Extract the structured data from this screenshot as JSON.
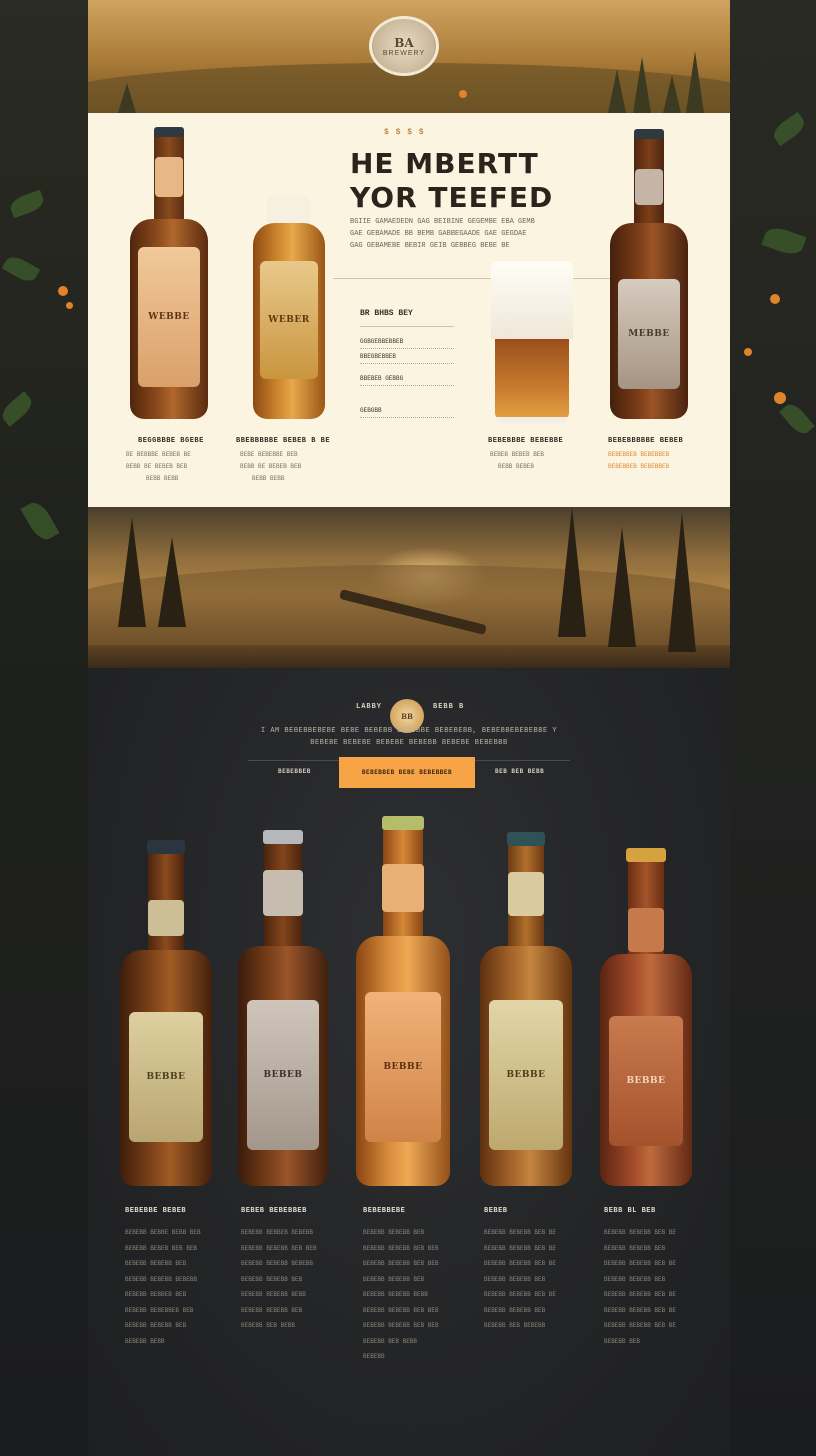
{
  "hero": {
    "badge_title": "BA",
    "badge_sub": "BREWERY"
  },
  "feature": {
    "kicker": "$ $ $ $",
    "headline_line1": "HE MBERTT",
    "headline_line2": "YOR TEEFED",
    "paragraph_lines": [
      "BGIIE GAMAEDEDN GAG BEIBINE GEGEMBE EBA GEMB",
      "GAE GEBAMADE BB BEMB GABBEGAADE GAE GEGDAE",
      "GAG GEBAMEBE BEBIR GEIB GEBBEG BEBE BE"
    ],
    "menu_title": "BR BHBS BEY",
    "menu_items": [
      "GGBGEBBEBBEB",
      "BBEGBEBBEB",
      "BBEBEB GEBBG",
      "GEBGBB"
    ],
    "products": [
      {
        "title": "BEGGBBBE BGEBE",
        "lines": [
          "BE BEBBBE BEBEB BE",
          "BEBB BE BEBEB BEB",
          "BEBB BEBB"
        ]
      },
      {
        "title": "BBEBBBBBE BEBEB B BE",
        "lines": [
          "BEBE BEBEBBE BEB",
          "BEBB BE BEBEB BEB",
          "BEBB BEBB"
        ]
      },
      {
        "title": "BEBEBBBE BEBEBBE",
        "lines": [
          "BEBEB BEBEB BEB",
          "BEBB BEBEB"
        ]
      },
      {
        "title": "BEBEBBBBBE BEBEB",
        "lines": [
          "BEBEBBEB BEBEBBEB",
          "BEBEBBEB BEBEBBEB"
        ]
      }
    ],
    "bottle_labels": [
      "WEBBE",
      "WEBER",
      "MEBBE"
    ]
  },
  "brand": {
    "left": "LABBY",
    "right": "BEBB B",
    "badge": "BB",
    "tagline1": "I AM BEBEBBEBEBE BEBE BEBEBB BEBEBBE BEBEBEBB, BEBEBBEBEBEBBE Y",
    "tagline2": "BEBEBE BEBEBE BEBEBE BEBEBB BEBEBE BEBEBBB"
  },
  "nav": {
    "left": "BEBEBBEB",
    "button": "BEBEBBEB BEBE BEBEBBEB",
    "right": "BEB BEB BEBB"
  },
  "lineup": [
    {
      "label": "BEBBE",
      "title": "BEBEBBE BEBEB",
      "lines": [
        "BEBEBB BEBBE BEBB BEB",
        "BEBEBB BEBEB BEB BEB",
        "BEBEBB BEBEBB BEB",
        "BEBEBB BEBEBB BEBEBB",
        "BEBEBB BEBBEB BEB",
        "BEBEBB BEBEBBEB BEB",
        "BEBEBB BEBEBB BEB",
        "BEBEBB BEBB"
      ]
    },
    {
      "label": "BEBEB",
      "title": "BEBEB BEBEBBEB",
      "lines": [
        "BEBEBB BEBBEB BEBEBB",
        "BEBEBB BEBEBB BEB BEB",
        "BEBEBB BEBEBB BEBEBB",
        "BEBEBB BEBEBB BEB",
        "BEBEBB BEBEBB BEBB",
        "BEBEBB BEBEBB BEB",
        "BEBEBB BEB BEBB"
      ]
    },
    {
      "label": "BEBBE",
      "title": "BEBEBBEBE",
      "lines": [
        "BEBEBB BEBEBB BEB",
        "BEBEBB BEBEBB BEB BEB",
        "BEBEBB BEBEBB BEB BEB",
        "BEBEBB BEBEBB BEB",
        "BEBEBB BEBEBB BEBB",
        "BEBEBB BEBEBB BEB BEB",
        "BEBEBB BEBEBB BEB BEB",
        "BEBEBB BEB BEBB",
        "BEBEBB"
      ]
    },
    {
      "label": "BEBBE",
      "title": "BEBEB",
      "lines": [
        "BEBEBB BEBEBB BEB BE",
        "BEBEBB BEBEBB BEB BE",
        "BEBEBB BEBEBB BEB BE",
        "BEBEBB BEBEBB BEB",
        "BEBEBB BEBEBB BEB BE",
        "BEBEBB BEBEBB BEB",
        "BEBEBB BEB BEBEBB"
      ]
    },
    {
      "label": "BEBBE",
      "title": "BEBB BL BEB",
      "lines": [
        "BEBEBB BEBEBB BEB BE",
        "BEBEBB BEBEBB BEB",
        "BEBEBB BEBEBB BEB BE",
        "BEBEBB BEBEBB BEB",
        "BEBEBB BEBEBB BEB BE",
        "BEBEBB BEBEBB BEB BE",
        "BEBEBB BEBEBB BEB BE",
        "BEBEBB BEB"
      ]
    }
  ],
  "colors": {
    "accent": "#f6a445",
    "cream": "#fbf4e0",
    "dark": "#242527"
  }
}
